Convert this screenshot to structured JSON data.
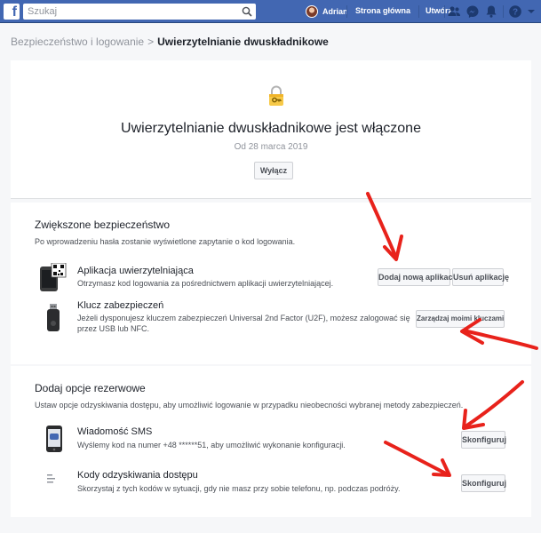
{
  "topbar": {
    "search_placeholder": "Szukaj",
    "user_name": "Adrian",
    "home_label": "Strona główna",
    "create_label": "Utwórz",
    "brand_color": "#4267b2"
  },
  "breadcrumb": {
    "parent": "Bezpieczeństwo i logowanie",
    "separator": ">",
    "current": "Uwierzytelnianie dwuskładnikowe"
  },
  "hero": {
    "title": "Uwierzytelnianie dwuskładnikowe jest włączone",
    "date": "Od 28 marca 2019",
    "disable_label": "Wyłącz"
  },
  "security_section": {
    "title": "Zwiększone bezpieczeństwo",
    "description": "Po wprowadzeniu hasła zostanie wyświetlone zapytanie o kod logowania.",
    "auth_app": {
      "title": "Aplikacja uwierzytelniająca",
      "description": "Otrzymasz kod logowania za pośrednictwem aplikacji uwierzytelniającej.",
      "add_label": "Dodaj nową aplikację",
      "remove_label": "Usuń aplikację"
    },
    "security_key": {
      "title": "Klucz zabezpieczeń",
      "description": "Jeżeli dysponujesz kluczem zabezpieczeń Universal 2nd Factor (U2F), możesz zalogować się przez USB lub NFC.",
      "manage_label": "Zarządzaj moimi kluczami"
    }
  },
  "backup_section": {
    "title": "Dodaj opcje rezerwowe",
    "description": "Ustaw opcje odzyskiwania dostępu, aby umożliwić logowanie w przypadku nieobecności wybranej metody zabezpieczeń.",
    "sms": {
      "title": "Wiadomość SMS",
      "description": "Wyślemy kod na numer +48 ******51, aby umożliwić wykonanie konfiguracji.",
      "configure_label": "Skonfiguruj"
    },
    "recovery_codes": {
      "title": "Kody odzyskiwania dostępu",
      "description": "Skorzystaj z tych kodów w sytuacji, gdy nie masz przy sobie telefonu, np. podczas podróży.",
      "configure_label": "Skonfiguruj"
    }
  },
  "annotations": {
    "arrow_color": "#e8221b"
  }
}
